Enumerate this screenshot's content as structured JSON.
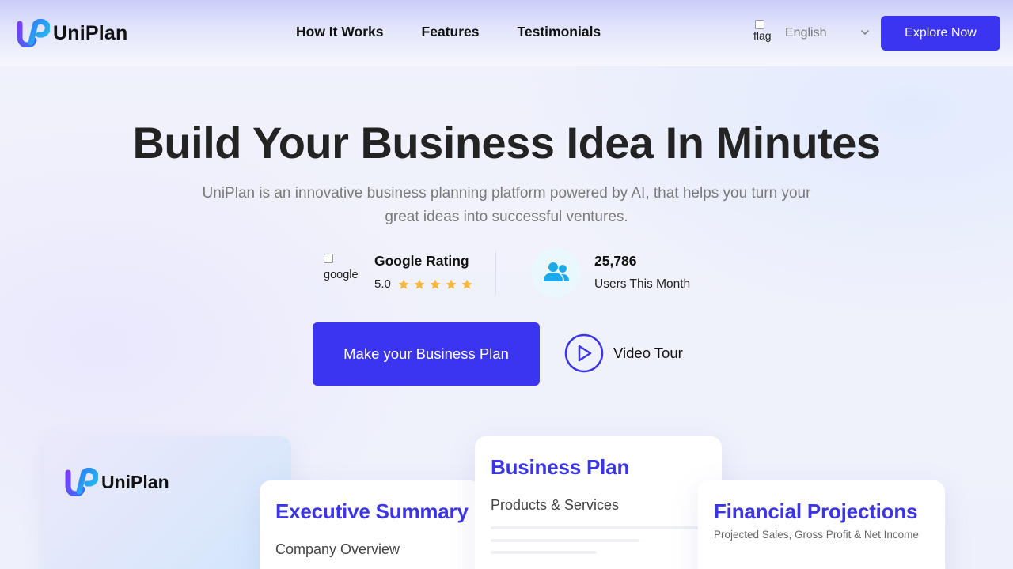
{
  "brand": {
    "name": "UniPlan"
  },
  "nav": {
    "items": [
      {
        "label": "How It Works"
      },
      {
        "label": "Features"
      },
      {
        "label": "Testimonials"
      }
    ]
  },
  "language": {
    "flag_alt": "flag",
    "selected": "English"
  },
  "header": {
    "explore_label": "Explore Now"
  },
  "hero": {
    "title": "Build Your Business Idea In Minutes",
    "subtitle": "UniPlan is an innovative business planning platform powered by AI, that helps you turn your great ideas into successful ventures."
  },
  "rating": {
    "image_alt": "google",
    "title": "Google Rating",
    "value": "5.0",
    "stars": 5
  },
  "users": {
    "count": "25,786",
    "label": "Users This Month"
  },
  "cta": {
    "primary_label": "Make your Business Plan",
    "video_label": "Video Tour"
  },
  "cards": {
    "logo_card": {
      "brand": "UniPlan"
    },
    "executive": {
      "title": "Executive Summary",
      "sub": "Company Overview"
    },
    "plan": {
      "title": "Business Plan",
      "sub": "Products & Services"
    },
    "financial": {
      "title": "Financial Projections",
      "sub": "Projected Sales, Gross Profit & Net Income"
    }
  },
  "colors": {
    "accent": "#3b35f2",
    "heading_accent": "#3b35e6",
    "star": "#f5b942",
    "users_icon": "#1ba9ea"
  }
}
